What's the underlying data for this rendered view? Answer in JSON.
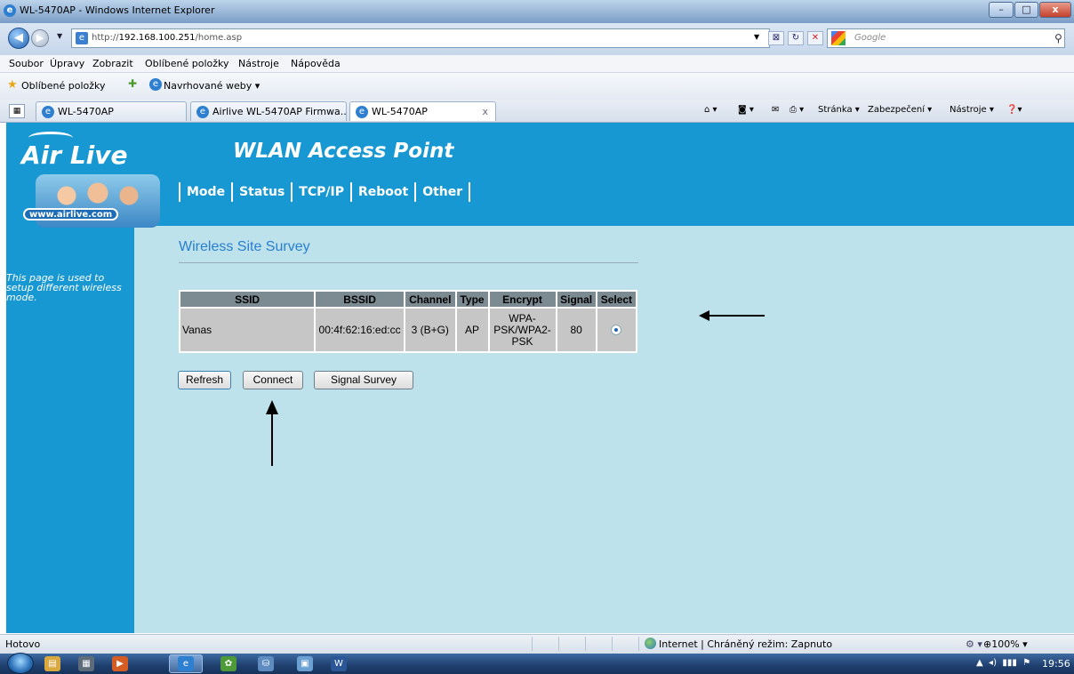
{
  "window": {
    "title": "WL-5470AP - Windows Internet Explorer",
    "min": "–",
    "max": "□",
    "close": "x"
  },
  "address": {
    "url_scheme": "http://",
    "url_host": "192.168.100.251",
    "url_path": "/home.asp",
    "search_placeholder": "Google"
  },
  "menu": [
    "Soubor",
    "Úpravy",
    "Zobrazit",
    "Oblíbené položky",
    "Nástroje",
    "Nápověda"
  ],
  "favorites": {
    "label": "Oblíbené položky",
    "suggested": "Navrhované weby ▾"
  },
  "tabs": [
    {
      "label": "WL-5470AP"
    },
    {
      "label": "Airlive WL-5470AP Firmwa..."
    },
    {
      "label": "WL-5470AP",
      "close": "x"
    }
  ],
  "command_bar": {
    "page": "Stránka ▾",
    "security": "Zabezpečení ▾",
    "tools": "Nástroje ▾"
  },
  "app": {
    "logo_text": "Air Live",
    "logo_url": "www.airlive.com",
    "title": "WLAN Access Point",
    "nav": [
      "Mode",
      "Status",
      "TCP/IP",
      "Reboot",
      "Other"
    ],
    "side_help": "This page is used to setup different wireless mode."
  },
  "survey": {
    "heading": "Wireless Site Survey",
    "columns": [
      "SSID",
      "BSSID",
      "Channel",
      "Type",
      "Encrypt",
      "Signal",
      "Select"
    ],
    "rows": [
      {
        "ssid": "Vanas",
        "bssid": "00:4f:62:16:ed:cc",
        "channel": "3 (B+G)",
        "type": "AP",
        "encrypt": "WPA-PSK/WPA2-PSK",
        "signal": "80",
        "selected": true
      }
    ],
    "buttons": {
      "refresh": "Refresh",
      "connect": "Connect",
      "signal_survey": "Signal Survey"
    }
  },
  "statusbar": {
    "status": "Hotovo",
    "zone": "Internet | Chráněný režim: Zapnuto",
    "zoom": "100%"
  },
  "taskbar": {
    "time": "19:56"
  }
}
